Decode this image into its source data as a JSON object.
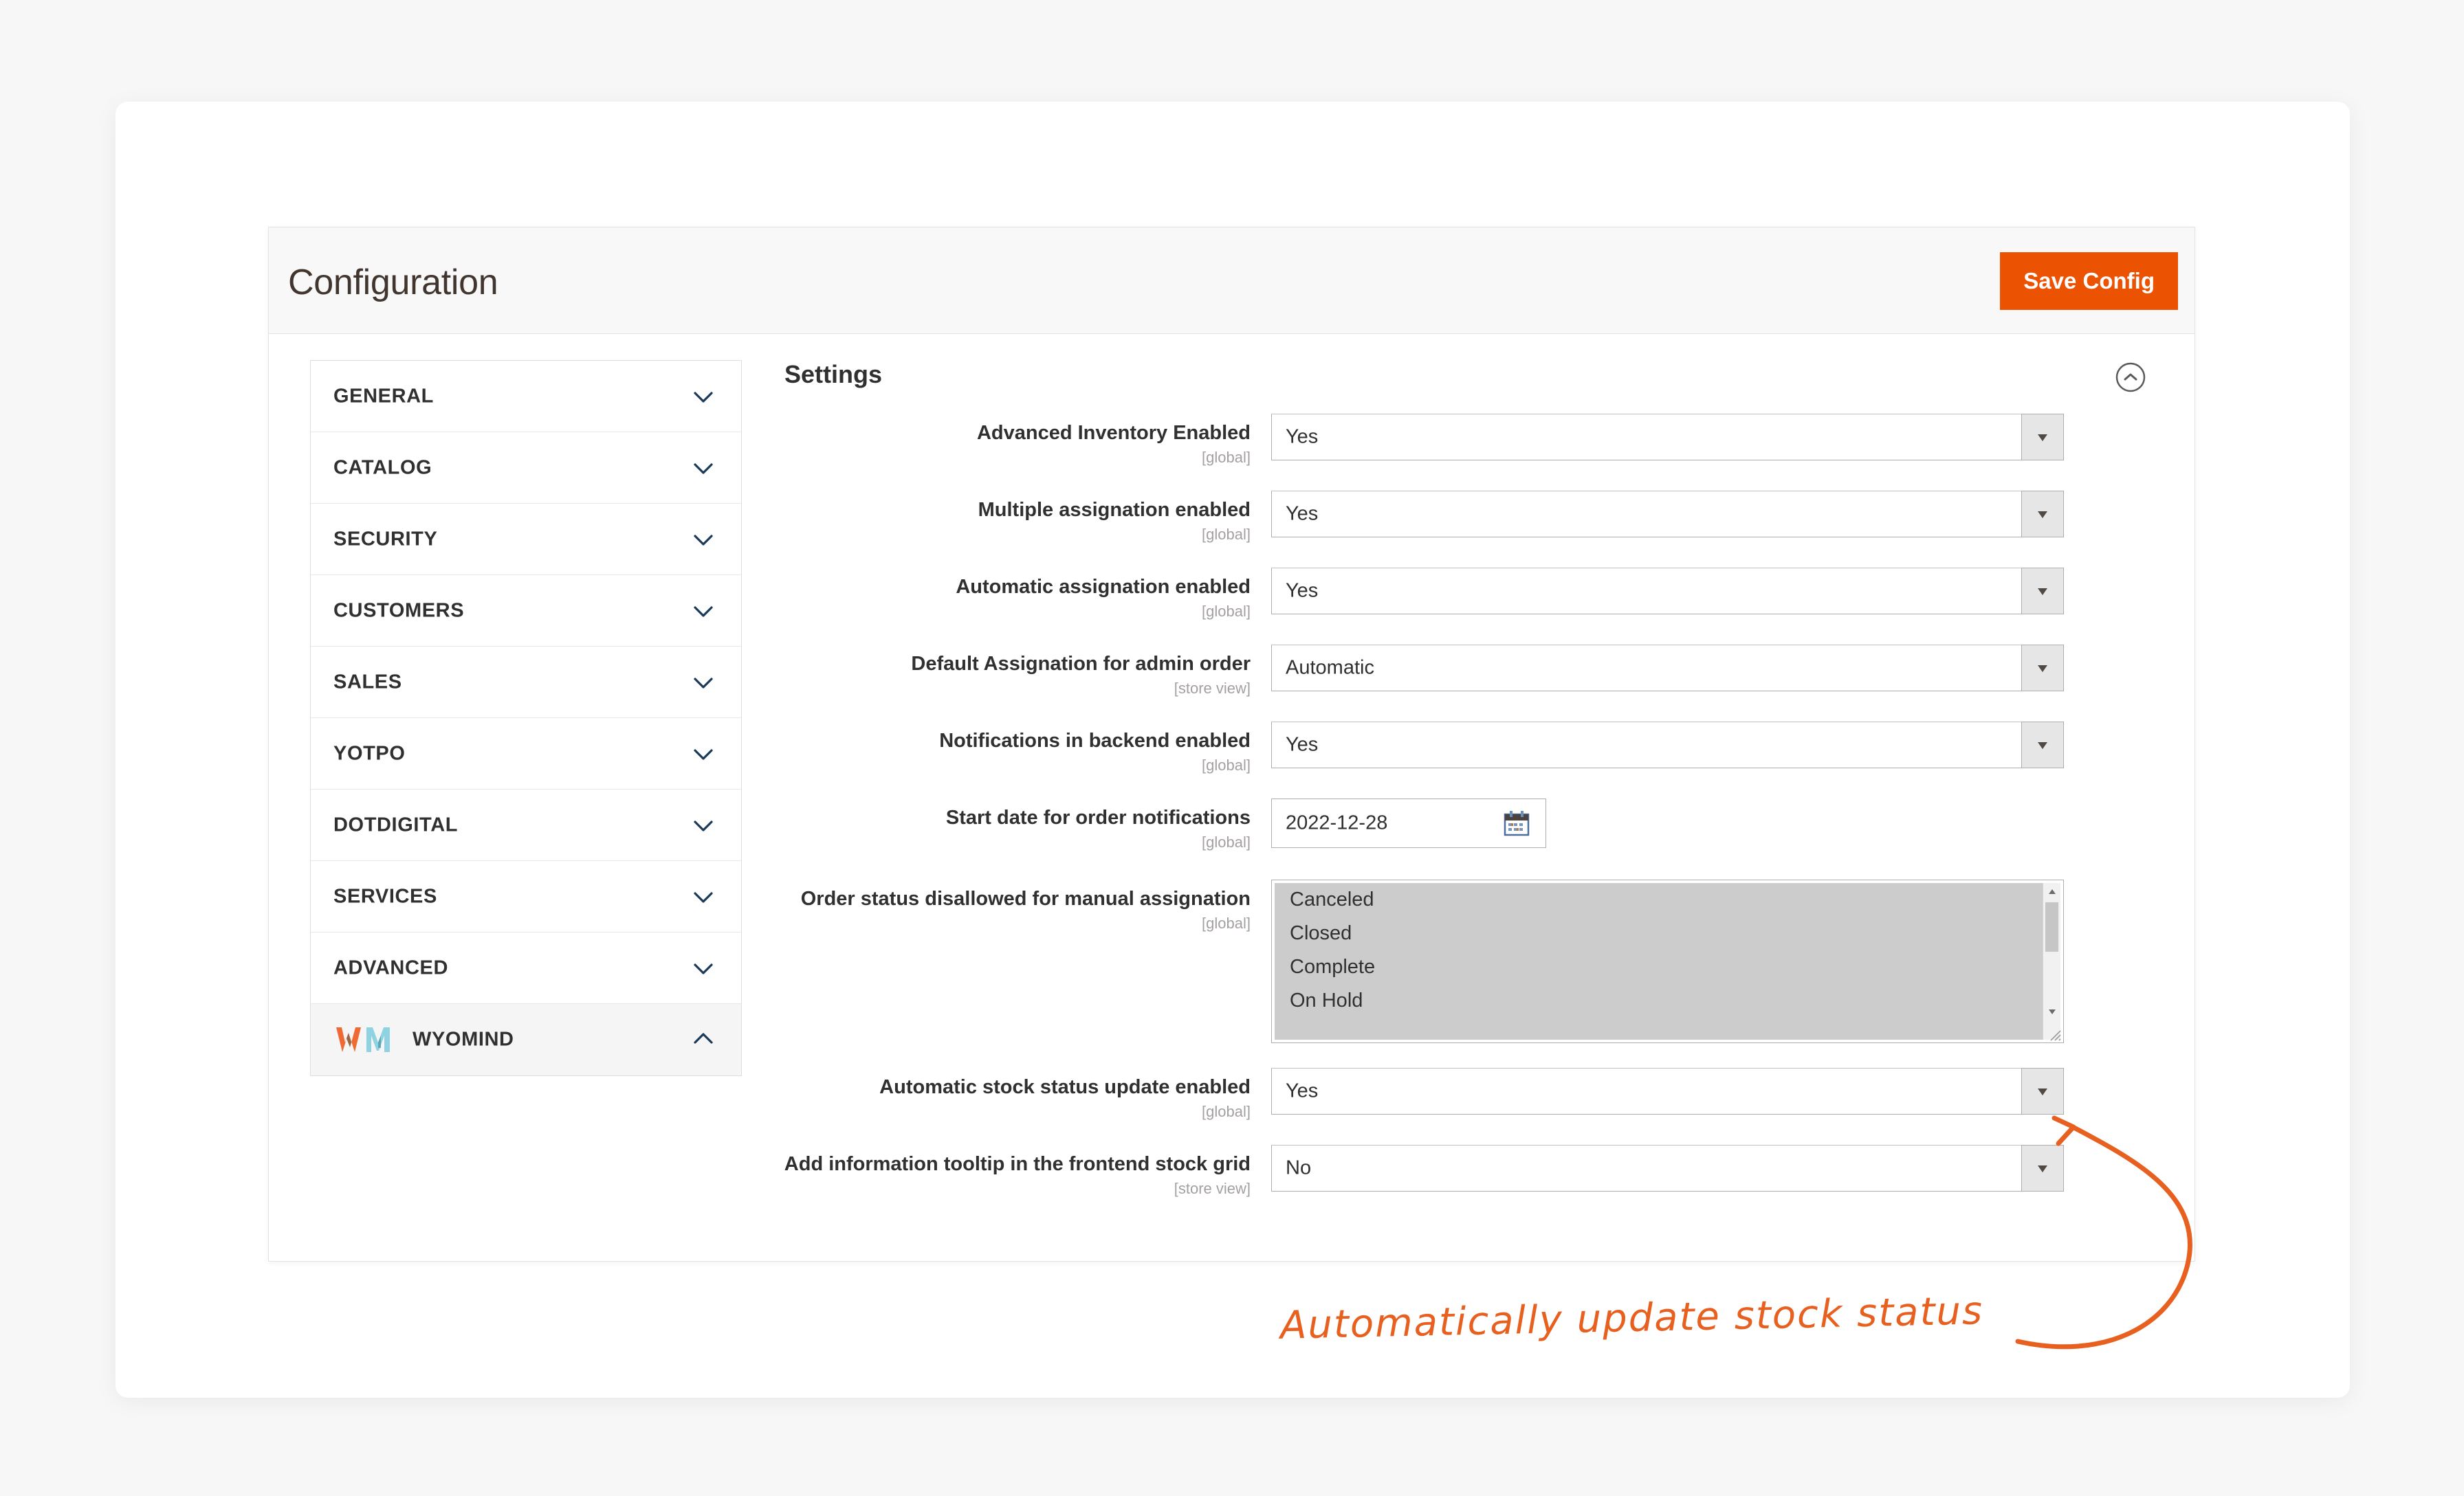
{
  "header": {
    "title": "Configuration",
    "save_label": "Save Config"
  },
  "sidebar": {
    "items": [
      {
        "label": "GENERAL",
        "state": "collapsed",
        "has_logo": false
      },
      {
        "label": "CATALOG",
        "state": "collapsed",
        "has_logo": false
      },
      {
        "label": "SECURITY",
        "state": "collapsed",
        "has_logo": false
      },
      {
        "label": "CUSTOMERS",
        "state": "collapsed",
        "has_logo": false
      },
      {
        "label": "SALES",
        "state": "collapsed",
        "has_logo": false
      },
      {
        "label": "YOTPO",
        "state": "collapsed",
        "has_logo": false
      },
      {
        "label": "DOTDIGITAL",
        "state": "collapsed",
        "has_logo": false
      },
      {
        "label": "SERVICES",
        "state": "collapsed",
        "has_logo": false
      },
      {
        "label": "ADVANCED",
        "state": "collapsed",
        "has_logo": false
      },
      {
        "label": "WYOMIND",
        "state": "expanded",
        "has_logo": true
      }
    ]
  },
  "settings": {
    "title": "Settings",
    "collapse_icon": "chevron-up-circle-icon",
    "fields": [
      {
        "label": "Advanced Inventory Enabled",
        "scope": "[global]",
        "type": "select",
        "value": "Yes"
      },
      {
        "label": "Multiple assignation enabled",
        "scope": "[global]",
        "type": "select",
        "value": "Yes"
      },
      {
        "label": "Automatic assignation enabled",
        "scope": "[global]",
        "type": "select",
        "value": "Yes"
      },
      {
        "label": "Default Assignation for admin order",
        "scope": "[store view]",
        "type": "select",
        "value": "Automatic"
      },
      {
        "label": "Notifications in backend enabled",
        "scope": "[global]",
        "type": "select",
        "value": "Yes"
      },
      {
        "label": "Start date for order notifications",
        "scope": "[global]",
        "type": "date",
        "value": "2022-12-28",
        "icon": "calendar-icon"
      },
      {
        "label": "Order status disallowed for manual assignation",
        "scope": "[global]",
        "type": "multiselect",
        "options": [
          "Canceled",
          "Closed",
          "Complete",
          "On Hold"
        ]
      },
      {
        "label": "Automatic stock status update enabled",
        "scope": "[global]",
        "type": "select",
        "value": "Yes"
      },
      {
        "label": "Add information tooltip in the frontend stock grid",
        "scope": "[store view]",
        "type": "select",
        "value": "No"
      }
    ]
  },
  "annotation": {
    "text": "Automatically update stock status",
    "color": "#e8601f"
  },
  "colors": {
    "accent_orange": "#eb5202",
    "annotation_orange": "#e8601f",
    "panel_bg": "#ffffff",
    "header_bg": "#f8f8f8",
    "page_bg": "#f7f7f7",
    "multiselect_bg": "#cccccc"
  }
}
